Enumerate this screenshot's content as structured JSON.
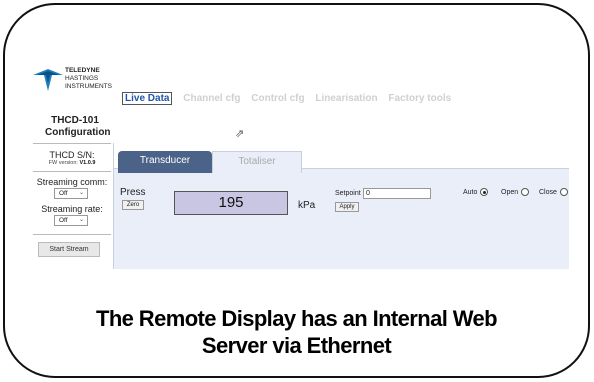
{
  "logo": {
    "brand": "TELEDYNE",
    "line2": "HASTINGS",
    "line3": "INSTRUMENTS"
  },
  "sidebar": {
    "title_line1": "THCD-101",
    "title_line2": "Configuration",
    "sn_label": "THCD S/N:",
    "fw_label": "FW version:",
    "fw_value": "V1.0.9",
    "streaming_comm_label": "Streaming comm:",
    "streaming_comm_value": "Off",
    "streaming_rate_label": "Streaming rate:",
    "streaming_rate_value": "Off",
    "start_stream_label": "Start Stream"
  },
  "nav": {
    "tabs": [
      {
        "label": "Live Data",
        "active": true
      },
      {
        "label": "Channel cfg",
        "active": false
      },
      {
        "label": "Control cfg",
        "active": false
      },
      {
        "label": "Linearisation",
        "active": false
      },
      {
        "label": "Factory tools",
        "active": false
      }
    ]
  },
  "panel": {
    "tabs": [
      "Transducer",
      "Totaliser"
    ],
    "press_label": "Press",
    "zero_label": "Zero",
    "value": "195",
    "unit": "kPa",
    "setpoint_label": "Setpoint",
    "setpoint_value": "0",
    "apply_label": "Apply",
    "modes": [
      {
        "label": "Auto",
        "selected": true
      },
      {
        "label": "Open",
        "selected": false
      },
      {
        "label": "Close",
        "selected": false
      }
    ]
  },
  "caption": {
    "line1": "The Remote Display has an Internal Web",
    "line2": "Server via Ethernet"
  },
  "colors": {
    "active_nav": "#1f55a8",
    "tab_active_bg": "#4c6389",
    "value_box_bg": "#c9c6e3",
    "panel_bg": "#e9eef8"
  }
}
